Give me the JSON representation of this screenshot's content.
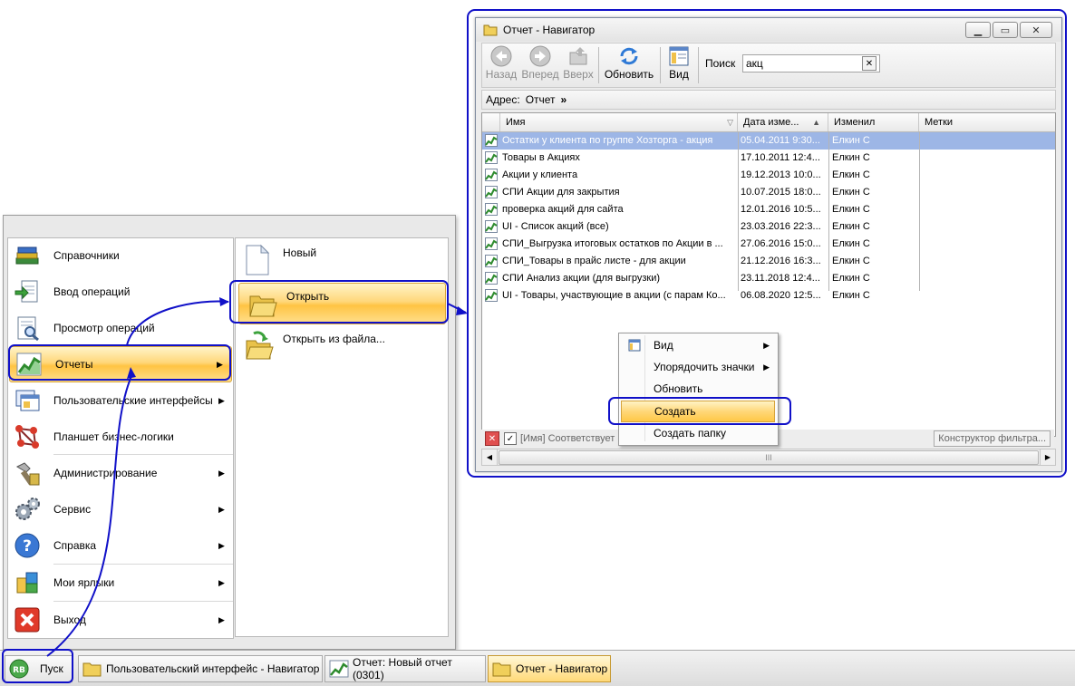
{
  "start_menu": {
    "items": [
      {
        "label": "Справочники",
        "icon": "books-icon",
        "has_submenu": false
      },
      {
        "label": "Ввод операций",
        "icon": "document-arrow-icon",
        "has_submenu": false
      },
      {
        "label": "Просмотр операций",
        "icon": "document-search-icon",
        "has_submenu": false
      },
      {
        "label": "Отчеты",
        "icon": "chart-icon",
        "has_submenu": true
      },
      {
        "label": "Пользовательские интерфейсы",
        "icon": "forms-icon",
        "has_submenu": true
      },
      {
        "label": "Планшет бизнес-логики",
        "icon": "molecule-icon",
        "has_submenu": false
      },
      {
        "label": "Администрирование",
        "icon": "wrench-icon",
        "has_submenu": true
      },
      {
        "label": "Сервис",
        "icon": "gears-icon",
        "has_submenu": true
      },
      {
        "label": "Справка",
        "icon": "help-icon",
        "has_submenu": true
      },
      {
        "label": "Мои ярлыки",
        "icon": "shortcuts-icon",
        "has_submenu": true
      },
      {
        "label": "Выход",
        "icon": "exit-icon",
        "has_submenu": true
      }
    ],
    "submenu": [
      {
        "label": "Новый",
        "icon": "new-document-icon"
      },
      {
        "label": "Открыть",
        "icon": "folder-open-icon"
      },
      {
        "label": "Открыть из файла...",
        "icon": "open-file-icon"
      }
    ]
  },
  "taskbar": {
    "start_label": "Пуск",
    "buttons": [
      {
        "label": "Пользовательский интерфейс - Навигатор",
        "icon": "folder-icon"
      },
      {
        "label": "Отчет: Новый отчет (0301)",
        "icon": "chart-icon"
      },
      {
        "label": "Отчет - Навигатор",
        "icon": "folder-icon"
      }
    ]
  },
  "window": {
    "title": "Отчет - Навигатор",
    "toolbar": {
      "back": "Назад",
      "forward": "Вперед",
      "up": "Вверх",
      "refresh": "Обновить",
      "view": "Вид",
      "search_label": "Поиск",
      "search_value": "акц"
    },
    "address_label": "Адрес:",
    "address_value": "Отчет",
    "address_chevron": "»",
    "columns": [
      "Имя",
      "Дата изме...",
      "Изменил",
      "Метки"
    ],
    "rows": [
      {
        "name": "Остатки у клиента по группе Хозторга - акция",
        "date": "05.04.2011 9:30...",
        "user": "Елкин С"
      },
      {
        "name": "Товары в Акциях",
        "date": "17.10.2011 12:4...",
        "user": "Елкин С"
      },
      {
        "name": "Акции у клиента",
        "date": "19.12.2013 10:0...",
        "user": "Елкин С"
      },
      {
        "name": "СПИ Акции для закрытия",
        "date": "10.07.2015 18:0...",
        "user": "Елкин С"
      },
      {
        "name": "проверка акций для сайта",
        "date": "12.01.2016 10:5...",
        "user": "Елкин С"
      },
      {
        "name": "UI - Список акций (все)",
        "date": "23.03.2016 22:3...",
        "user": "Елкин С"
      },
      {
        "name": "СПИ_Выгрузка итоговых остатков по Акции в ...",
        "date": "27.06.2016 15:0...",
        "user": "Елкин С"
      },
      {
        "name": "СПИ_Товары в прайс листе - для акции",
        "date": "21.12.2016 16:3...",
        "user": "Елкин С"
      },
      {
        "name": "СПИ Анализ акции (для выгрузки)",
        "date": "23.11.2018 12:4...",
        "user": "Елкин С"
      },
      {
        "name": "UI - Товары, участвующие в акции (с парам Ко...",
        "date": "06.08.2020 12:5...",
        "user": "Елкин С"
      }
    ],
    "filter_text": "[Имя] Соответствует",
    "filter_builder": "Конструктор фильтра...",
    "scroll_grip": "III"
  },
  "context_menu": {
    "items": [
      {
        "label": "Вид",
        "has_submenu": true,
        "icon": "view-icon"
      },
      {
        "label": "Упорядочить значки",
        "has_submenu": true
      },
      {
        "label": "Обновить",
        "has_submenu": false
      },
      {
        "label": "Создать",
        "has_submenu": false
      },
      {
        "label": "Создать папку",
        "has_submenu": false
      }
    ]
  },
  "colors": {
    "highlight_row": "#9db6e6",
    "selection_gold": "#ffc443",
    "annotation_blue": "#1010c8"
  }
}
